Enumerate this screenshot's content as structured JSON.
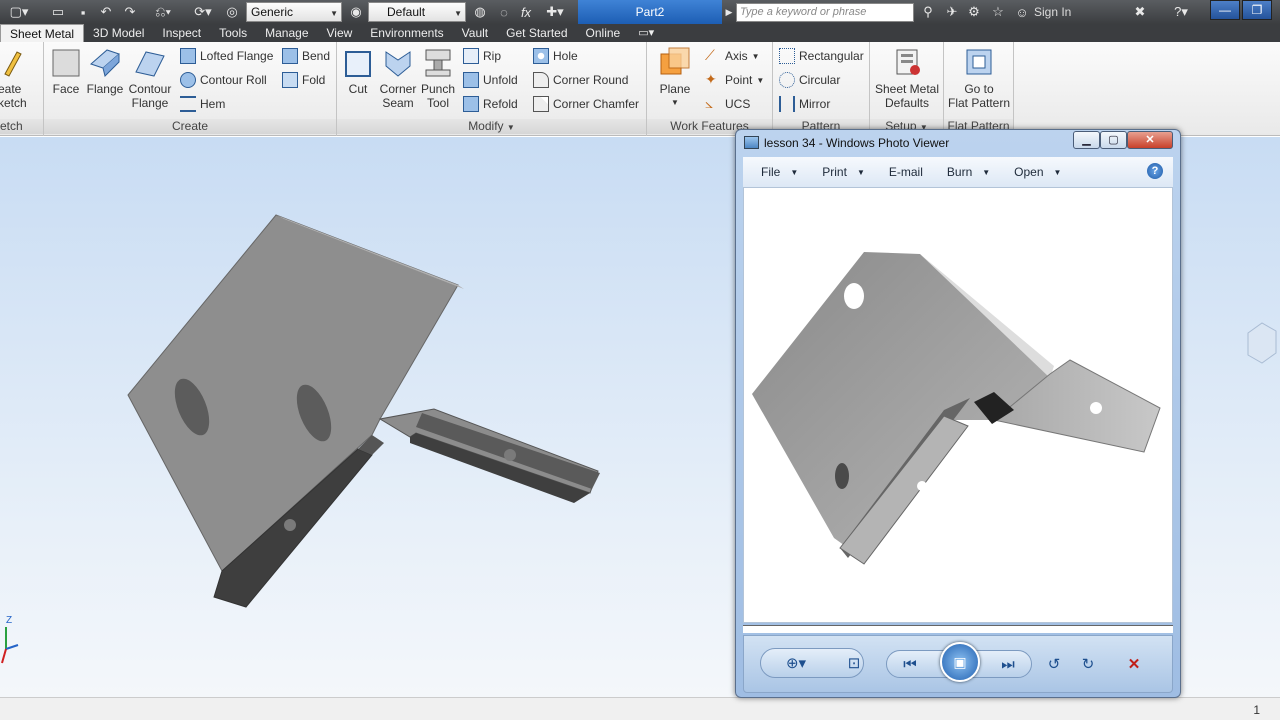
{
  "title_bar": {
    "style_combo": "Generic",
    "appearance_combo": "Default",
    "fx_label": "fx",
    "document_title": "Part2",
    "search_placeholder": "Type a keyword or phrase",
    "sign_in": "Sign In"
  },
  "tabs": [
    "Sheet Metal",
    "3D Model",
    "Inspect",
    "Tools",
    "Manage",
    "View",
    "Environments",
    "Vault",
    "Get Started",
    "Online"
  ],
  "active_tab": "Sheet Metal",
  "ribbon": {
    "sketch": {
      "label_line1": "eate",
      "label_line2": "ketch",
      "group": "etch"
    },
    "create": {
      "group": "Create",
      "face": "Face",
      "flange": "Flange",
      "contour_flange_1": "Contour",
      "contour_flange_2": "Flange",
      "lofted_flange": "Lofted Flange",
      "contour_roll": "Contour Roll",
      "hem": "Hem",
      "bend": "Bend",
      "fold": "Fold"
    },
    "modify": {
      "group": "Modify",
      "cut": "Cut",
      "corner_seam_1": "Corner",
      "corner_seam_2": "Seam",
      "punch_tool_1": "Punch",
      "punch_tool_2": "Tool",
      "rip": "Rip",
      "unfold": "Unfold",
      "refold": "Refold",
      "hole": "Hole",
      "corner_round": "Corner Round",
      "corner_chamfer": "Corner Chamfer"
    },
    "work_features": {
      "group": "Work Features",
      "plane": "Plane",
      "axis": "Axis",
      "point": "Point",
      "ucs": "UCS"
    },
    "pattern": {
      "group": "Pattern",
      "rectangular": "Rectangular",
      "circular": "Circular",
      "mirror": "Mirror"
    },
    "setup": {
      "group": "Setup",
      "defaults_1": "Sheet Metal",
      "defaults_2": "Defaults"
    },
    "flat_pattern": {
      "group": "Flat Pattern",
      "goto_1": "Go to",
      "goto_2": "Flat Pattern"
    }
  },
  "photo_viewer": {
    "title": "lesson 34 - Windows Photo Viewer",
    "menu": [
      "File",
      "Print",
      "E-mail",
      "Burn",
      "Open"
    ],
    "menu_has_dropdown": [
      true,
      true,
      false,
      true,
      true
    ]
  },
  "status": {
    "page": "1"
  },
  "axis_labels": {
    "z": "Z"
  },
  "colors": {
    "accent": "#1d5eb4",
    "part_gray": "#8e8e8e",
    "canvas_top": "#c8dcf3"
  }
}
